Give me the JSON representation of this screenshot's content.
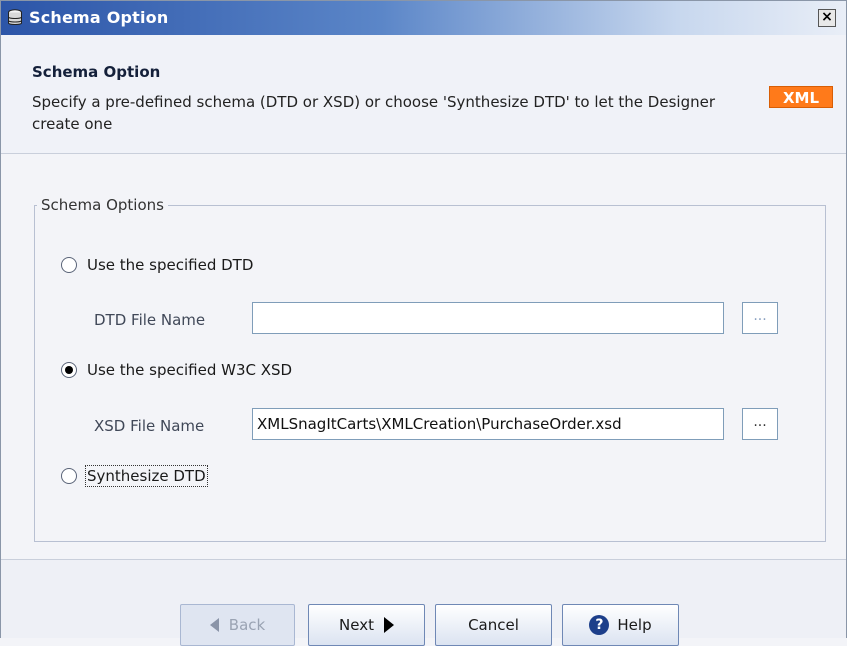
{
  "window": {
    "title": "Schema Option",
    "close_glyph": "×"
  },
  "header": {
    "title": "Schema Option",
    "description": "Specify a pre-defined schema (DTD or XSD) or choose 'Synthesize DTD' to let the Designer create one",
    "badge": "XML",
    "badge_color": "#ff7a1a"
  },
  "group": {
    "legend": "Schema Options",
    "options": [
      {
        "label": "Use the specified DTD",
        "selected": false
      },
      {
        "label": "Use the specified W3C XSD",
        "selected": true
      },
      {
        "label": "Synthesize DTD",
        "selected": false
      }
    ],
    "dtd_field": {
      "label": "DTD File Name",
      "value": "",
      "browse_label": "..."
    },
    "xsd_field": {
      "label": "XSD File Name",
      "value": "XMLSnagItCarts\\XMLCreation\\PurchaseOrder.xsd",
      "browse_label": "..."
    }
  },
  "buttons": {
    "back": "Back",
    "next": "Next",
    "cancel": "Cancel",
    "help": "Help",
    "help_icon_glyph": "?"
  },
  "icons": {
    "app": "database-icon",
    "close": "close-icon",
    "back": "arrow-left-icon",
    "next": "arrow-right-icon",
    "help": "help-icon"
  }
}
